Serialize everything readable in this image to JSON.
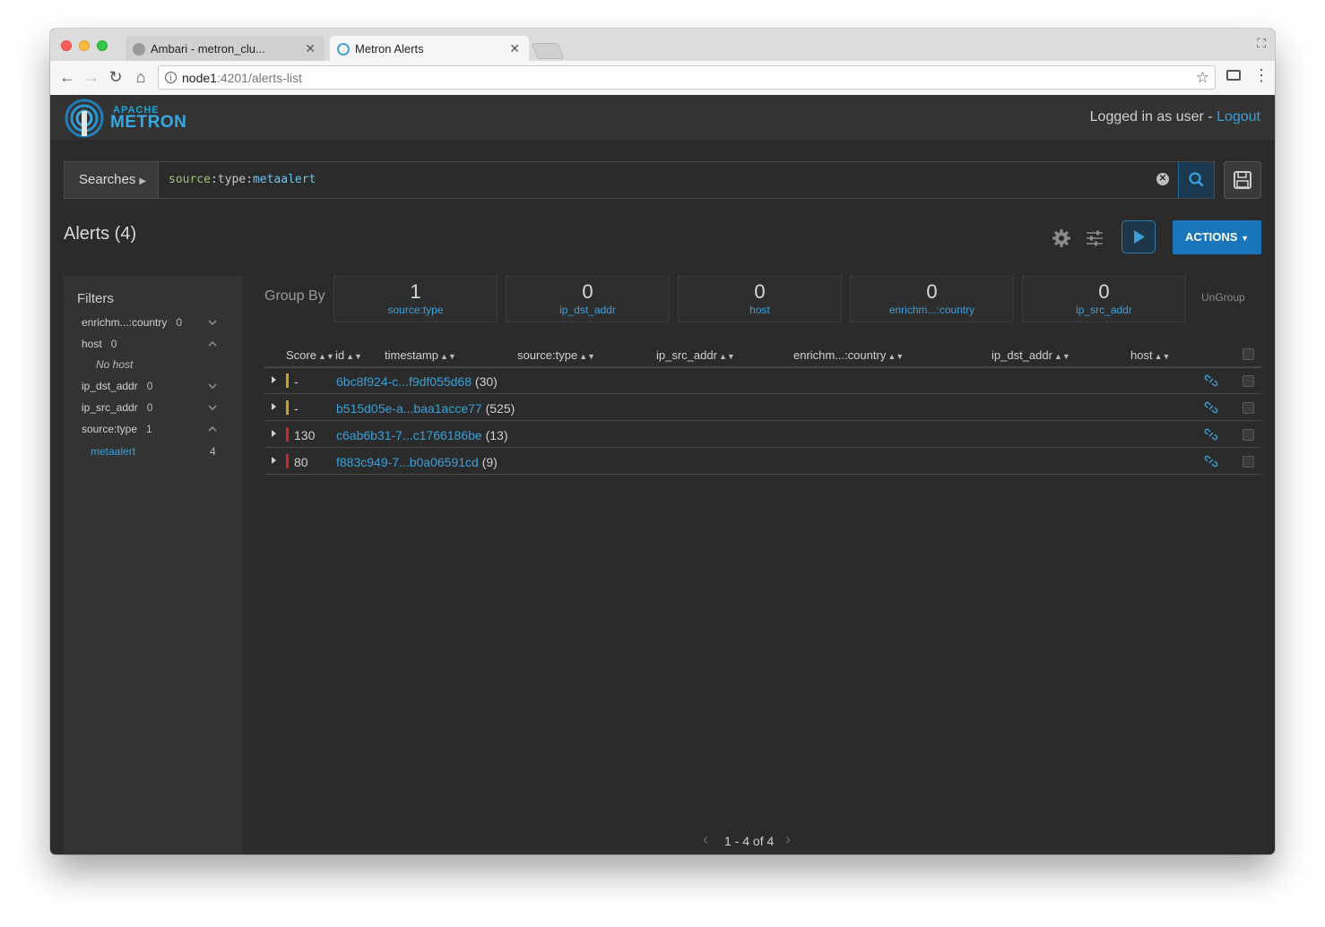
{
  "browser": {
    "tabs": [
      {
        "title": "Ambari - metron_clu..."
      },
      {
        "title": "Metron Alerts"
      }
    ],
    "url_host": "node1",
    "url_path": ":4201/alerts-list"
  },
  "header": {
    "logo_top": "APACHE",
    "logo_bottom": "METRON",
    "login_text": "Logged in as user - ",
    "logout_label": "Logout"
  },
  "search": {
    "searches_label": "Searches",
    "query_key": "source",
    "query_sep": ":type:",
    "query_value": "metaalert"
  },
  "alerts": {
    "title": "Alerts (4)",
    "actions_label": "ACTIONS"
  },
  "filters": {
    "title": "Filters",
    "items": [
      {
        "label": "enrichm...:country",
        "count": "0"
      },
      {
        "label": "host",
        "count": "0"
      },
      {
        "label": "ip_dst_addr",
        "count": "0"
      },
      {
        "label": "ip_src_addr",
        "count": "0"
      },
      {
        "label": "source:type",
        "count": "1"
      }
    ],
    "host_empty": "No host",
    "source_type_value": {
      "label": "metaalert",
      "count": "4"
    }
  },
  "group_by": {
    "label": "Group By",
    "cards": [
      {
        "value": "1",
        "label": "source:type"
      },
      {
        "value": "0",
        "label": "ip_dst_addr"
      },
      {
        "value": "0",
        "label": "host"
      },
      {
        "value": "0",
        "label": "enrichm...:country"
      },
      {
        "value": "0",
        "label": "ip_src_addr"
      }
    ],
    "ungroup_label": "UnGroup"
  },
  "table": {
    "columns": [
      "Score",
      "id",
      "timestamp",
      "source:type",
      "ip_src_addr",
      "enrichm...:country",
      "ip_dst_addr",
      "host"
    ],
    "rows": [
      {
        "score": "-",
        "id": "6bc8f924-c...f9df055d68",
        "count": "(30)",
        "color": "#c9a227"
      },
      {
        "score": "-",
        "id": "b515d05e-a...baa1acce77",
        "count": "(525)",
        "color": "#c9a227"
      },
      {
        "score": "130",
        "id": "c6ab6b31-7...c1766186be",
        "count": "(13)",
        "color": "#d0262c"
      },
      {
        "score": "80",
        "id": "f883c949-7...b0a06591cd",
        "count": "(9)",
        "color": "#d0262c"
      }
    ]
  },
  "pagination": {
    "text": "1 - 4 of 4"
  },
  "colors": {
    "accent": "#1b75bb",
    "link": "#3aa0d8",
    "background": "#2b2b2b"
  }
}
